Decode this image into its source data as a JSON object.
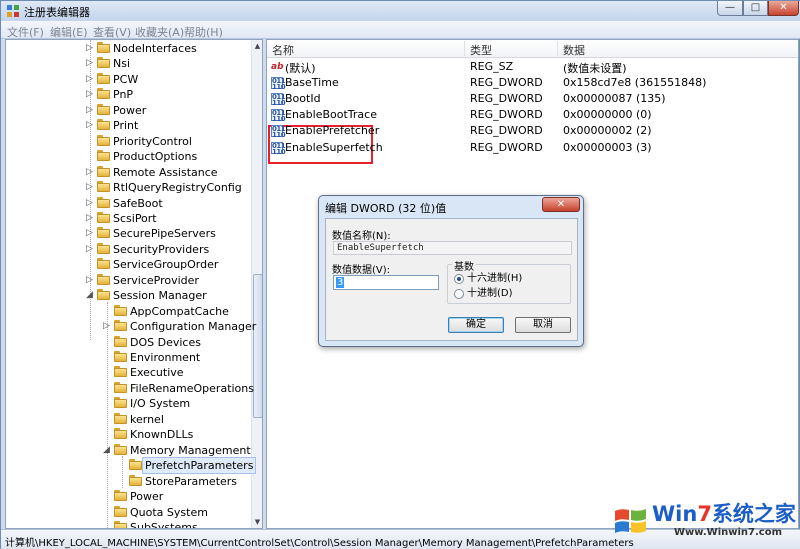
{
  "window": {
    "title": "注册表编辑器",
    "buttons": {
      "minimize": "—",
      "maximize": "□",
      "close": "✕"
    }
  },
  "menu": [
    "文件(F)",
    "编辑(E)",
    "查看(V)",
    "收藏夹(A)",
    "帮助(H)"
  ],
  "tree": {
    "items": [
      {
        "label": "NodeInterfaces",
        "level": 1,
        "expander": "▷"
      },
      {
        "label": "Nsi",
        "level": 1,
        "expander": "▷"
      },
      {
        "label": "PCW",
        "level": 1,
        "expander": "▷"
      },
      {
        "label": "PnP",
        "level": 1,
        "expander": "▷"
      },
      {
        "label": "Power",
        "level": 1,
        "expander": "▷"
      },
      {
        "label": "Print",
        "level": 1,
        "expander": "▷"
      },
      {
        "label": "PriorityControl",
        "level": 1,
        "expander": ""
      },
      {
        "label": "ProductOptions",
        "level": 1,
        "expander": ""
      },
      {
        "label": "Remote Assistance",
        "level": 1,
        "expander": "▷"
      },
      {
        "label": "RtlQueryRegistryConfig",
        "level": 1,
        "expander": "▷"
      },
      {
        "label": "SafeBoot",
        "level": 1,
        "expander": "▷"
      },
      {
        "label": "ScsiPort",
        "level": 1,
        "expander": "▷"
      },
      {
        "label": "SecurePipeServers",
        "level": 1,
        "expander": "▷"
      },
      {
        "label": "SecurityProviders",
        "level": 1,
        "expander": "▷"
      },
      {
        "label": "ServiceGroupOrder",
        "level": 1,
        "expander": ""
      },
      {
        "label": "ServiceProvider",
        "level": 1,
        "expander": "▷"
      },
      {
        "label": "Session Manager",
        "level": 1,
        "expander": "◢"
      },
      {
        "label": "AppCompatCache",
        "level": 2,
        "expander": ""
      },
      {
        "label": "Configuration Manager",
        "level": 2,
        "expander": "▷"
      },
      {
        "label": "DOS Devices",
        "level": 2,
        "expander": ""
      },
      {
        "label": "Environment",
        "level": 2,
        "expander": ""
      },
      {
        "label": "Executive",
        "level": 2,
        "expander": ""
      },
      {
        "label": "FileRenameOperations",
        "level": 2,
        "expander": ""
      },
      {
        "label": "I/O System",
        "level": 2,
        "expander": ""
      },
      {
        "label": "kernel",
        "level": 2,
        "expander": ""
      },
      {
        "label": "KnownDLLs",
        "level": 2,
        "expander": ""
      },
      {
        "label": "Memory Management",
        "level": 2,
        "expander": "◢"
      },
      {
        "label": "PrefetchParameters",
        "level": 3,
        "expander": "",
        "selected": true
      },
      {
        "label": "StoreParameters",
        "level": 3,
        "expander": ""
      },
      {
        "label": "Power",
        "level": 2,
        "expander": ""
      },
      {
        "label": "Quota System",
        "level": 2,
        "expander": ""
      },
      {
        "label": "SubSystems",
        "level": 2,
        "expander": ""
      }
    ]
  },
  "list": {
    "headers": {
      "name": "名称",
      "type": "类型",
      "data": "数据"
    },
    "rows": [
      {
        "icon": "ab",
        "name": "(默认)",
        "type": "REG_SZ",
        "data": "(数值未设置)"
      },
      {
        "icon": "dw",
        "name": "BaseTime",
        "type": "REG_DWORD",
        "data": "0x158cd7e8 (361551848)"
      },
      {
        "icon": "dw",
        "name": "BootId",
        "type": "REG_DWORD",
        "data": "0x00000087 (135)"
      },
      {
        "icon": "dw",
        "name": "EnableBootTrace",
        "type": "REG_DWORD",
        "data": "0x00000000 (0)"
      },
      {
        "icon": "dw",
        "name": "EnablePrefetcher",
        "type": "REG_DWORD",
        "data": "0x00000002 (2)"
      },
      {
        "icon": "dw",
        "name": "EnableSuperfetch",
        "type": "REG_DWORD",
        "data": "0x00000003 (3)"
      }
    ],
    "highlight_color": "#e8202a"
  },
  "dialog": {
    "title": "编辑 DWORD (32 位)值",
    "close": "✕",
    "name_label": "数值名称(N):",
    "name_value": "EnableSuperfetch",
    "data_label": "数值数据(V):",
    "data_value": "3",
    "base_label": "基数",
    "radio_hex": "十六进制(H)",
    "radio_dec": "十进制(D)",
    "ok": "确定",
    "cancel": "取消"
  },
  "status": {
    "path": "计算机\\HKEY_LOCAL_MACHINE\\SYSTEM\\CurrentControlSet\\Control\\Session Manager\\Memory Management\\PrefetchParameters"
  },
  "watermark": {
    "brand_part1": "Win",
    "brand_part2": "7",
    "brand_part3": "系统之家",
    "url": "Www.Winwin7.com"
  }
}
